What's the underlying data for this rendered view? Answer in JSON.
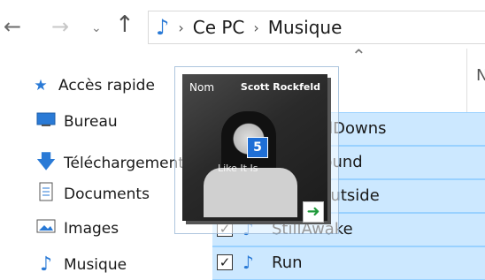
{
  "nav": {
    "back_icon": "arrow-left-icon",
    "forward_icon": "arrow-right-icon",
    "recent_icon": "chevron-down-icon",
    "up_icon": "arrow-up-icon"
  },
  "address_bar": {
    "breadcrumbs": [
      "Ce PC",
      "Musique"
    ],
    "folder_icon": "music-note-icon"
  },
  "sidebar": {
    "items": [
      {
        "label": "Accès rapide",
        "icon": "star-icon"
      },
      {
        "label": "Bureau",
        "icon": "desktop-icon"
      },
      {
        "label": "Téléchargements",
        "icon": "download-icon"
      },
      {
        "label": "Documents",
        "icon": "document-icon"
      },
      {
        "label": "Images",
        "icon": "image-icon"
      },
      {
        "label": "Musique",
        "icon": "music-note-icon"
      }
    ]
  },
  "file_list": {
    "column_header_partial": "N",
    "rows": [
      {
        "title": "UpsAndDowns",
        "checked": true
      },
      {
        "title": "TurnAround",
        "checked": true
      },
      {
        "title": "TakeItOutside",
        "checked": true
      },
      {
        "title": "StillAwake",
        "checked": true
      },
      {
        "title": "Run",
        "checked": true
      }
    ]
  },
  "drag_preview": {
    "artist": "Scott Rockfeld",
    "subtitle": "Like It Is",
    "column_name_ghost": "Nom",
    "count": "5",
    "action_icon": "move-arrow-icon"
  },
  "colors": {
    "selection_bg": "#cce8ff",
    "selection_border": "#99d1ff",
    "accent": "#2a7ad6",
    "badge": "#1f6fd6"
  }
}
